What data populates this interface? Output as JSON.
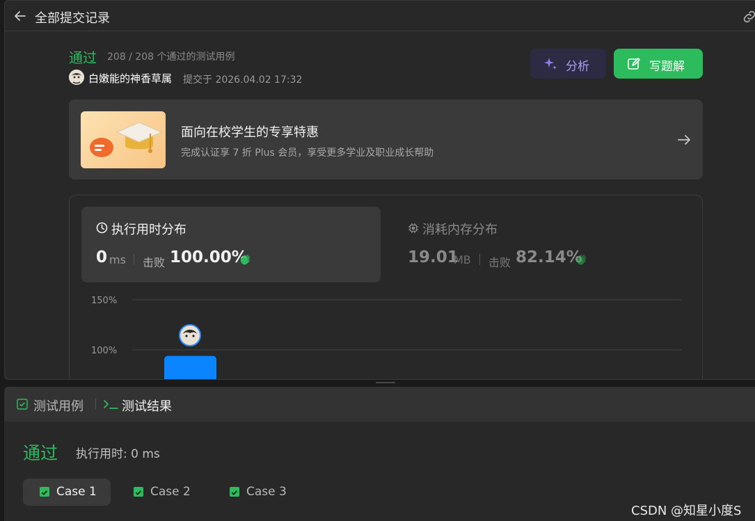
{
  "header": {
    "title": "全部提交记录",
    "back_icon": "arrow-left-icon",
    "share_icon": "link-icon"
  },
  "submission": {
    "status": "通过",
    "testcases": "208 / 208 个通过的测试用例",
    "user": "白嫩能的神香草属",
    "submitted_at": "提交于 2026.04.02 17:32"
  },
  "actions": {
    "analyze_label": "分析",
    "solution_label": "写题解"
  },
  "promo": {
    "title": "面向在校学生的专享特惠",
    "subtitle": "完成认证享 7 折 Plus 会员，享受更多学业及职业成长帮助"
  },
  "stats": {
    "runtime": {
      "title": "执行用时分布",
      "value": "0",
      "unit": "ms",
      "beat_label": "击败",
      "beat_value": "100.00%"
    },
    "memory": {
      "title": "消耗内存分布",
      "value": "19.01",
      "unit": "MB",
      "beat_label": "击败",
      "beat_value": "82.14%"
    }
  },
  "chart_data": {
    "type": "bar",
    "y_ticks": [
      "150%",
      "100%"
    ],
    "ylim": [
      0,
      150
    ],
    "values": [
      94
    ],
    "bar_color": "#0a84ff"
  },
  "bottom": {
    "tabs": [
      {
        "label": "测试用例"
      },
      {
        "label": "测试结果"
      }
    ],
    "result_status": "通过",
    "result_runtime": "执行用时: 0 ms",
    "cases": [
      {
        "label": "Case 1"
      },
      {
        "label": "Case 2"
      },
      {
        "label": "Case 3"
      }
    ]
  },
  "watermark": "CSDN @知星小度S",
  "colors": {
    "accent_green": "#2cbb5d",
    "analyze_purple": "#a99df5",
    "panel_bg": "#282828"
  }
}
